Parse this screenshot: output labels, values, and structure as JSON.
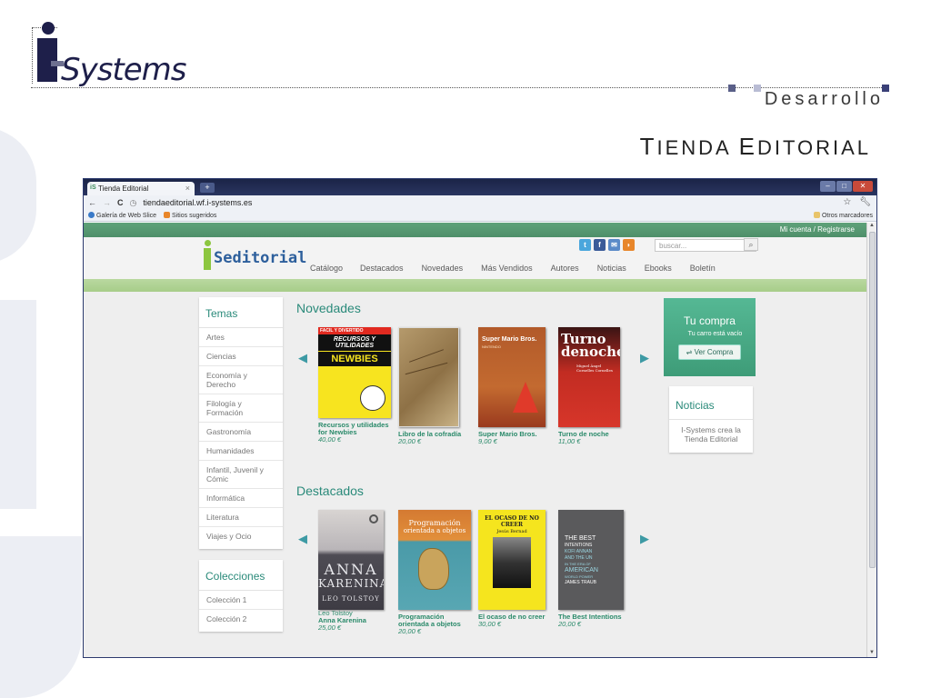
{
  "slide": {
    "logo_text": "Systems",
    "header_right": "Desarrollo",
    "title_cap1": "T",
    "title_rest1": "IENDA ",
    "title_cap2": "E",
    "title_rest2": "DITORIAL"
  },
  "browser": {
    "tab_title": "Tienda Editorial",
    "tab_close": "×",
    "new_tab": "+",
    "url": "tiendaeditorial.wf.i-systems.es",
    "bookmarks": [
      {
        "label": "Galería de Web Slice"
      },
      {
        "label": "Sitios sugeridos"
      }
    ],
    "other_bookmarks": "Otros marcadores"
  },
  "site": {
    "account_link": "Mi cuenta / Registrarse",
    "logo_text": "Seditorial",
    "search_placeholder": "buscar...",
    "nav": [
      "Catálogo",
      "Destacados",
      "Novedades",
      "Más Vendidos",
      "Autores",
      "Noticias",
      "Ebooks",
      "Boletín"
    ],
    "temas": {
      "title": "Temas",
      "items": [
        "Artes",
        "Ciencias",
        "Economía y Derecho",
        "Filología y Formación",
        "Gastronomía",
        "Humanidades",
        "Infantil, Juvenil y Cómic",
        "Informática",
        "Literatura",
        "Viajes y Ocio"
      ]
    },
    "colecciones": {
      "title": "Colecciones",
      "items": [
        "Colección 1",
        "Colección 2"
      ]
    },
    "novedades": {
      "title": "Novedades",
      "books": [
        {
          "title": "Recursos y utilidades for Newbies",
          "price": "40,00 €",
          "cover": [
            "FACIL Y DIVERTIDO",
            "RECURSOS Y UTILIDADES",
            "NEWBIES"
          ]
        },
        {
          "title": "Libro de la cofradía",
          "price": "20,00 €"
        },
        {
          "title": "Super Mario Bros.",
          "price": "9,00 €",
          "cover": [
            "Super Mario Bros.",
            "NINTENDO"
          ]
        },
        {
          "title": "Turno de noche",
          "price": "11,00 €",
          "cover": [
            "Turno",
            "denoche",
            "Miguel Ángel Cornelles Cornelles"
          ]
        }
      ]
    },
    "destacados": {
      "title": "Destacados",
      "books": [
        {
          "author": "Leo Tolstoy",
          "title": "Anna Karenina",
          "price": "25,00 €",
          "cover": [
            "ANNA",
            "KARENINA",
            "LEO TOLSTOY"
          ]
        },
        {
          "title": "Programación orientada a objetos",
          "price": "20,00 €",
          "cover": [
            "Programación",
            "orientada a objetos"
          ]
        },
        {
          "title": "El ocaso de no creer",
          "price": "30,00 €",
          "cover": [
            "EL OCASO DE NO CREER",
            "Jesús Bernad"
          ]
        },
        {
          "title": "The Best Intentions",
          "price": "20,00 €",
          "cover": [
            "THE BEST",
            "INTENTIONS",
            "KOFI ANNAN",
            "AND THE UN",
            "IN THE ERA OF",
            "AMERICAN",
            "WORLD POWER",
            "JAMES TRAUB"
          ]
        }
      ]
    },
    "compra": {
      "title": "Tu compra",
      "empty": "Tu carro está vacío",
      "button": "Ver Compra"
    },
    "noticias": {
      "title": "Noticias",
      "item": "I-Systems crea la Tienda Editorial"
    }
  },
  "colors": {
    "accent_green": "#2a8a7a",
    "header_green": "#5fa27a",
    "navy": "#1e1f4a"
  }
}
